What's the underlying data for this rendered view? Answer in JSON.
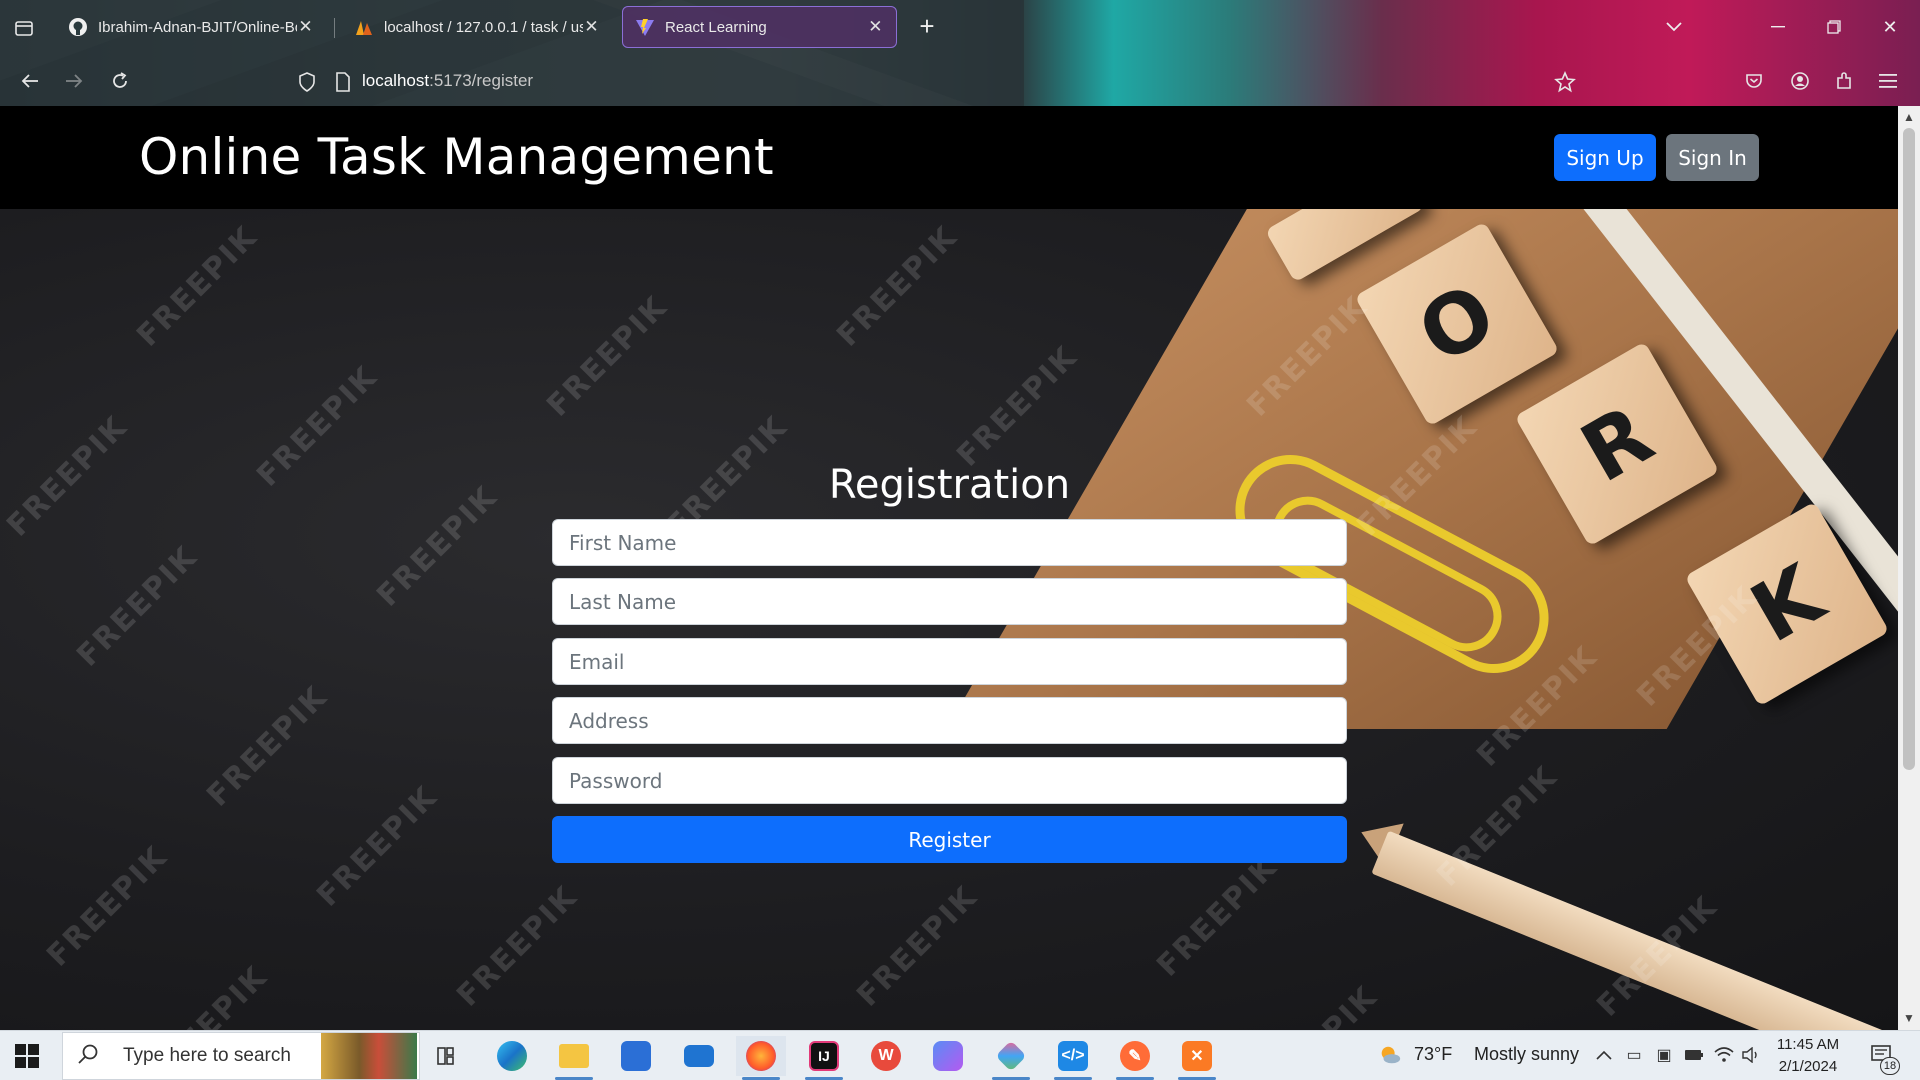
{
  "browser": {
    "tabs": [
      {
        "title": "Ibrahim-Adnan-BJIT/Online-Bo",
        "active": false
      },
      {
        "title": "localhost / 127.0.0.1 / task / use",
        "active": false
      },
      {
        "title": "React Learning",
        "active": true
      }
    ],
    "url_host": "localhost",
    "url_path": ":5173/register"
  },
  "app": {
    "brand": "Online Task Management",
    "signup_label": "Sign Up",
    "signin_label": "Sign In"
  },
  "form": {
    "title": "Registration",
    "fields": [
      {
        "placeholder": "First Name"
      },
      {
        "placeholder": "Last Name"
      },
      {
        "placeholder": "Email"
      },
      {
        "placeholder": "Address"
      },
      {
        "placeholder": "Password"
      }
    ],
    "submit_label": "Register"
  },
  "hero": {
    "watermark": "FREEPIK",
    "tiles": [
      "O",
      "R",
      "K"
    ]
  },
  "taskbar": {
    "search_placeholder": "Type here to search",
    "weather_temp": "73°F",
    "weather_text": "Mostly sunny",
    "time": "11:45 AM",
    "date": "2/1/2024",
    "notification_count": "18"
  },
  "colors": {
    "primary": "#0d6efd",
    "secondary": "#6c757d",
    "header_bg": "#000000"
  }
}
